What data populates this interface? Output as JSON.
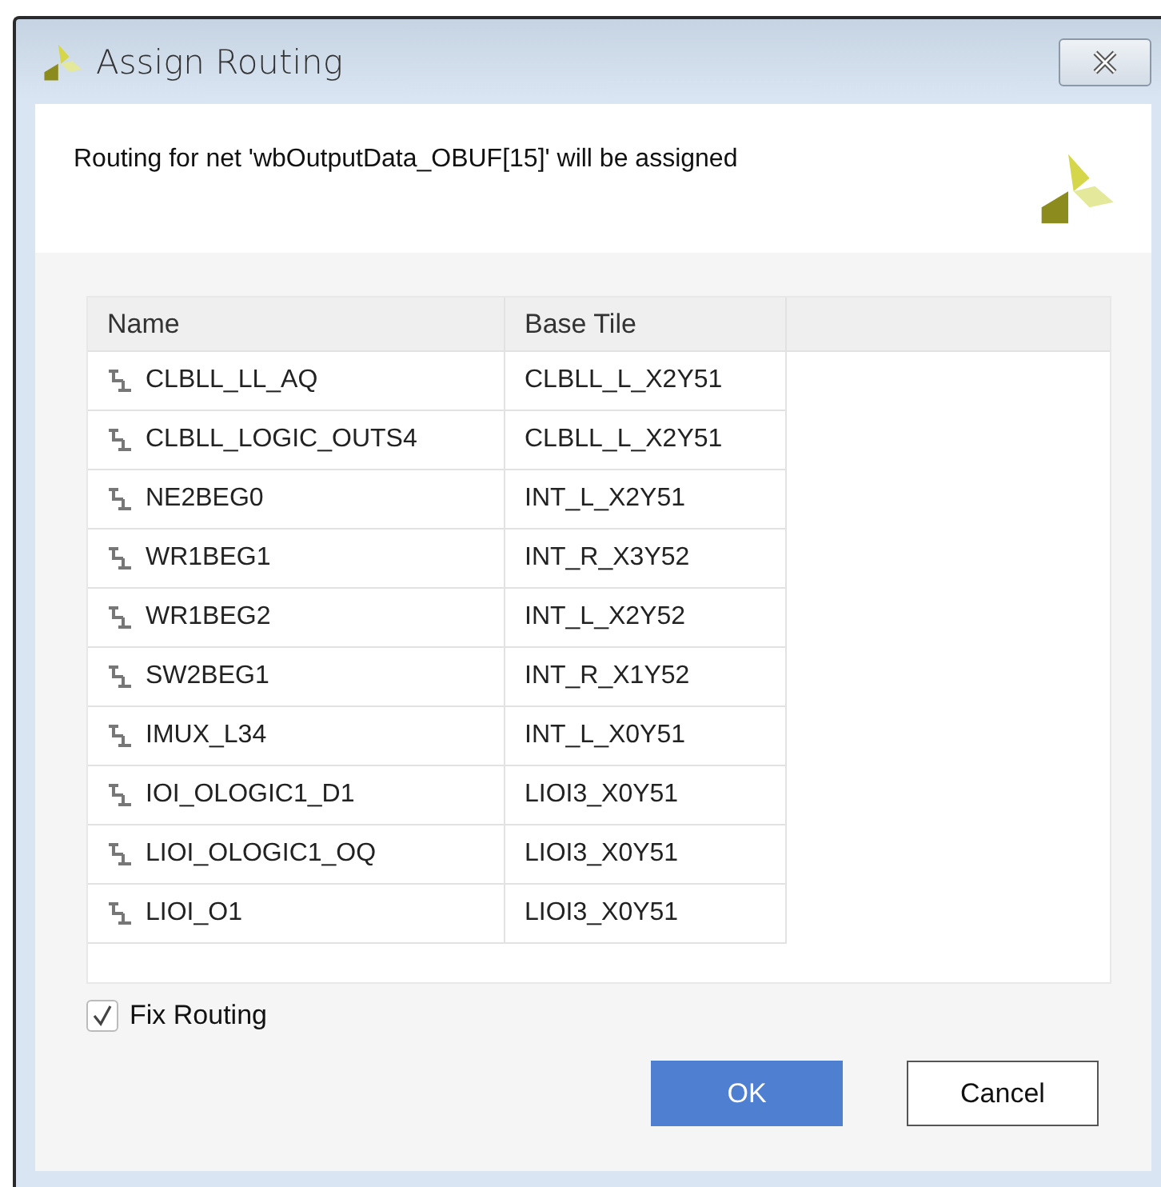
{
  "window": {
    "title": "Assign Routing"
  },
  "header": {
    "message": "Routing for net 'wbOutputData_OBUF[15]' will be assigned"
  },
  "table": {
    "columns": [
      "Name",
      "Base Tile"
    ],
    "rows": [
      {
        "name": "CLBLL_LL_AQ",
        "base_tile": "CLBLL_L_X2Y51"
      },
      {
        "name": "CLBLL_LOGIC_OUTS4",
        "base_tile": "CLBLL_L_X2Y51"
      },
      {
        "name": "NE2BEG0",
        "base_tile": "INT_L_X2Y51"
      },
      {
        "name": "WR1BEG1",
        "base_tile": "INT_R_X3Y52"
      },
      {
        "name": "WR1BEG2",
        "base_tile": "INT_L_X2Y52"
      },
      {
        "name": "SW2BEG1",
        "base_tile": "INT_R_X1Y52"
      },
      {
        "name": "IMUX_L34",
        "base_tile": "INT_L_X0Y51"
      },
      {
        "name": "IOI_OLOGIC1_D1",
        "base_tile": "LIOI3_X0Y51"
      },
      {
        "name": "LIOI_OLOGIC1_OQ",
        "base_tile": "LIOI3_X0Y51"
      },
      {
        "name": "LIOI_O1",
        "base_tile": "LIOI3_X0Y51"
      }
    ]
  },
  "fix_routing": {
    "label": "Fix Routing",
    "checked": true
  },
  "buttons": [
    {
      "label": "OK",
      "kind": "primary"
    },
    {
      "label": "Cancel",
      "kind": "secondary"
    }
  ]
}
